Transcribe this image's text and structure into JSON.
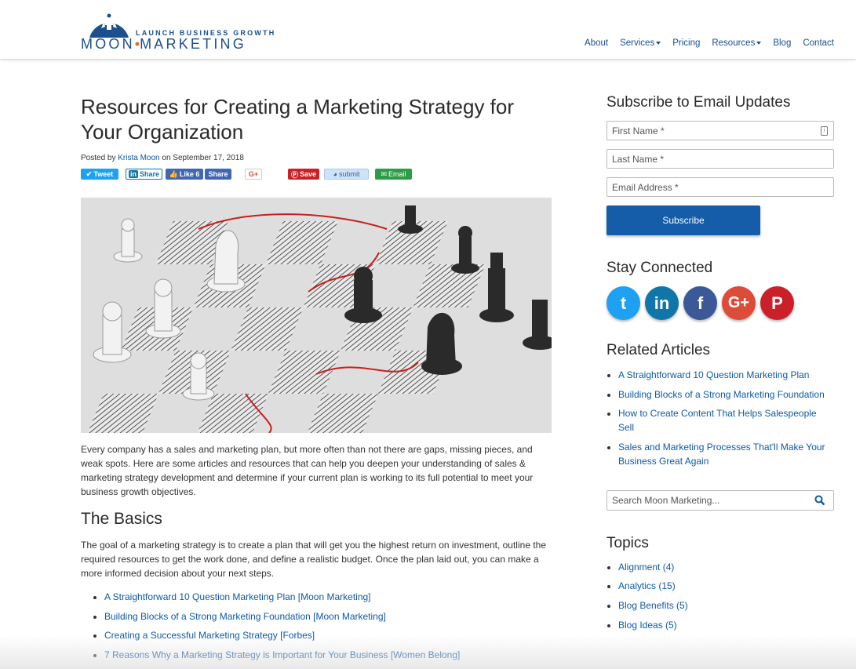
{
  "header": {
    "logo_tagline": "LAUNCH BUSINESS GROWTH",
    "logo_word_left": "MOON",
    "logo_dot": "•",
    "logo_word_right": "MARKETING",
    "nav": [
      {
        "label": "About"
      },
      {
        "label": "Services"
      },
      {
        "label": "Pricing"
      },
      {
        "label": "Resources"
      },
      {
        "label": "Blog"
      },
      {
        "label": "Contact"
      }
    ]
  },
  "article": {
    "title": "Resources for Creating a Marketing Strategy for Your Organization",
    "byline_prefix": "Posted by",
    "author": "Krista Moon",
    "byline_date": "on September 17, 2018",
    "share": {
      "tweet": "Tweet",
      "linkedin": "Share",
      "like": "Like 6",
      "fb_share": "Share",
      "gplus": "G+",
      "save": "Save",
      "submit": "submit",
      "email": "Email"
    },
    "intro": "Every company has a sales and marketing plan, but more often than not there are gaps, missing pieces, and weak spots. Here are some articles and resources that can help you deepen your understanding of sales & marketing strategy development and determine if your current plan is working to its full potential to meet your business growth objectives.",
    "section_heading": "The Basics",
    "section_text": "The goal of a marketing strategy is to create a plan that will get you the highest return on investment, outline the required resources to get the work done, and define a realistic budget. Once the plan laid out, you can make a more informed decision about your next steps.",
    "links": [
      "A Straightforward 10 Question Marketing Plan [Moon Marketing]",
      "Building Blocks of a Strong Marketing Foundation [Moon Marketing]",
      "Creating a Successful Marketing Strategy [Forbes]",
      "7 Reasons Why a Marketing Strategy is Important for Your Business [Women Belong]"
    ]
  },
  "sidebar": {
    "subscribe_heading": "Subscribe to Email Updates",
    "first_name": "First Name *",
    "last_name": "Last Name *",
    "email": "Email Address *",
    "subscribe_button": "Subscribe",
    "stay_heading": "Stay Connected",
    "social": [
      {
        "icon": "twitter-icon",
        "glyph": "t",
        "color": "#1ea1f2"
      },
      {
        "icon": "linkedin-icon",
        "glyph": "in",
        "color": "#0e76a8"
      },
      {
        "icon": "facebook-icon",
        "glyph": "f",
        "color": "#3b5998"
      },
      {
        "icon": "google-plus-icon",
        "glyph": "G+",
        "color": "#dd4b39"
      },
      {
        "icon": "pinterest-icon",
        "glyph": "P",
        "color": "#cb2027"
      }
    ],
    "related_heading": "Related Articles",
    "related": [
      "A Straightforward 10 Question Marketing Plan",
      "Building Blocks of a Strong Marketing Foundation",
      "How to Create Content That Helps Salespeople Sell",
      "Sales and Marketing Processes That'll Make Your Business Great Again"
    ],
    "search_placeholder": "Search Moon Marketing...",
    "topics_heading": "Topics",
    "topics": [
      "Alignment (4)",
      "Analytics (15)",
      "Blog Benefits (5)",
      "Blog Ideas (5)"
    ]
  }
}
